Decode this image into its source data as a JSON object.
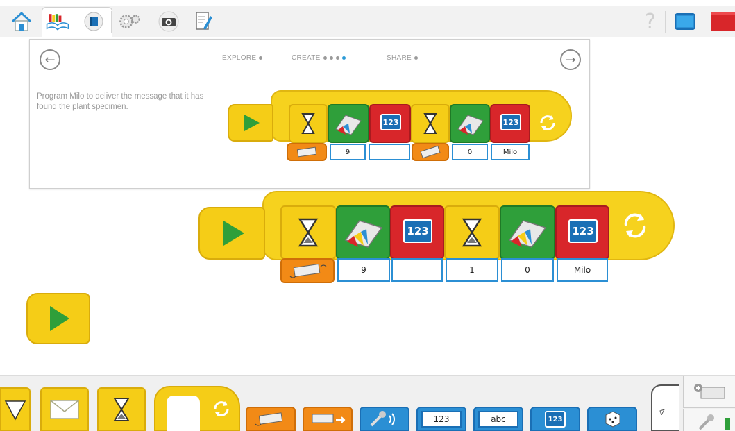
{
  "card": {
    "steps": {
      "explore": "EXPLORE",
      "create": "CREATE",
      "share": "SHARE"
    },
    "description": "Program Milo to deliver the message that it has found the plant specimen."
  },
  "sample_program": {
    "inputs": [
      "9",
      "",
      "0",
      "Milo"
    ],
    "display_label": "123"
  },
  "main_program": {
    "inputs": [
      "9",
      "",
      "1",
      "0",
      "Milo"
    ],
    "display_label": "123"
  },
  "palette": {
    "number_label": "123",
    "text_label": "abc",
    "display_label": "123"
  },
  "icons": {
    "home": "home-icon",
    "library": "library-icon",
    "settings": "gears-icon",
    "camera": "camera-icon",
    "document": "document-icon",
    "help": "help-icon",
    "screen": "screen-icon",
    "stop": "stop-icon"
  },
  "colors": {
    "start_yellow": "#f5cd17",
    "motor_green": "#2f9f3a",
    "display_red": "#d8262a",
    "sensor_orange": "#f28a16",
    "input_blue": "#2b8fd4",
    "stop_red": "#d8262a"
  }
}
